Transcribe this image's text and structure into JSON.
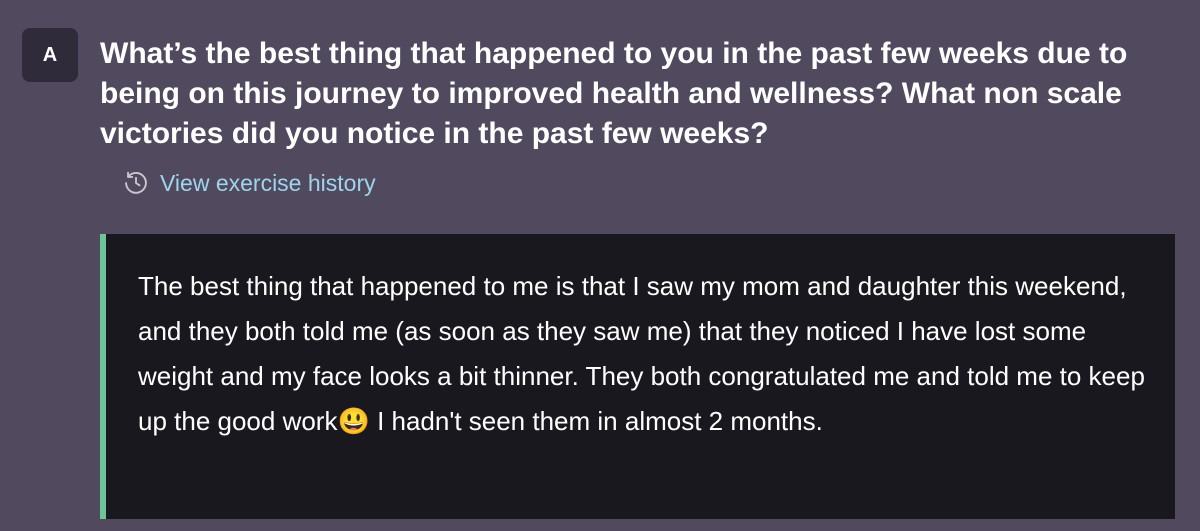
{
  "badge": {
    "letter": "A"
  },
  "question": {
    "text": "What’s the best thing that happened to you in the past few weeks due to being on this journey to improved health and wellness? What non scale victories did you notice in the past few weeks?"
  },
  "history_link": {
    "label": "View exercise history",
    "icon": "history-clock-icon"
  },
  "answer": {
    "text": "The best thing that happened to me is that I saw my mom and daughter this weekend, and they both told me (as soon as they saw me) that they noticed I have lost some weight and my face looks a bit thinner. They both congratulated me and told me to keep up the good work😃 I hadn't seen them in almost 2 months."
  },
  "colors": {
    "background": "#514a5f",
    "badge": "#2f2b3a",
    "answer_box": "#19181f",
    "accent_border": "#6cc596",
    "link": "#9fd4ea"
  }
}
